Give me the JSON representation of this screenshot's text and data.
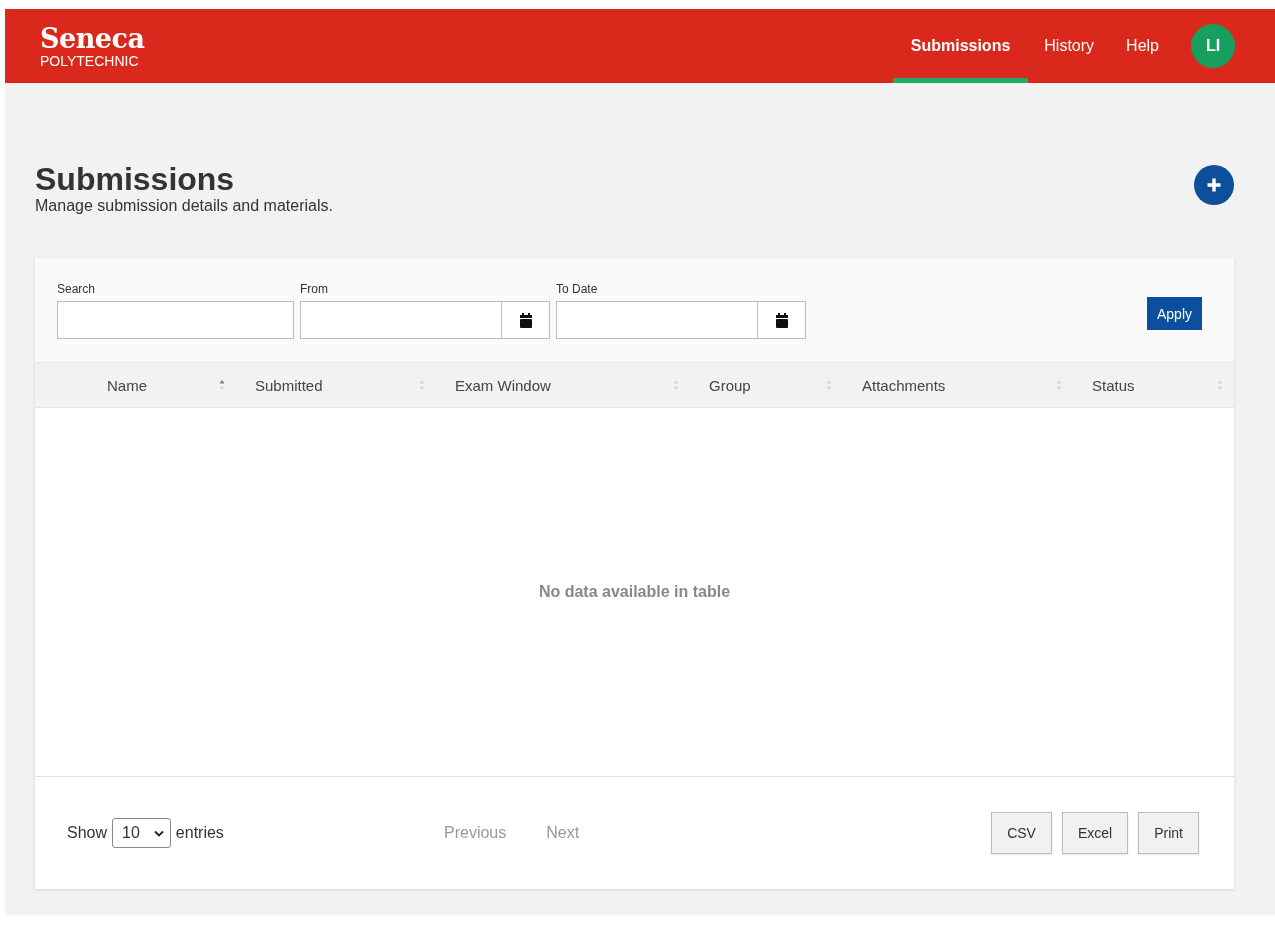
{
  "brand": {
    "name": "Seneca",
    "sub": "POLYTECHNIC"
  },
  "nav": [
    {
      "label": "Submissions",
      "selected": true
    },
    {
      "label": "History",
      "selected": false
    },
    {
      "label": "Help",
      "selected": false
    }
  ],
  "user": {
    "initials": "LI"
  },
  "page": {
    "title": "Submissions",
    "subtitle": "Manage submission details and materials."
  },
  "filters": [
    {
      "label": "Search",
      "kind": "text"
    },
    {
      "label": "From",
      "kind": "date"
    },
    {
      "label": "To Date",
      "kind": "date"
    }
  ],
  "apply_button": "Apply",
  "table": {
    "columns": [
      {
        "label": "Name",
        "sorted": true
      },
      {
        "label": "Submitted",
        "sorted": false
      },
      {
        "label": "Exam Window",
        "sorted": false
      },
      {
        "label": "Group",
        "sorted": false
      },
      {
        "label": "Attachments",
        "sorted": false
      },
      {
        "label": "Status",
        "sorted": false
      }
    ],
    "empty_message": "No data available in table"
  },
  "length": {
    "before": "Show",
    "value": "10",
    "after": "entries"
  },
  "pager": [
    {
      "label": "Previous",
      "disabled": true
    },
    {
      "label": "Next",
      "disabled": true
    }
  ],
  "export_buttons": [
    "CSV",
    "Excel",
    "Print"
  ]
}
